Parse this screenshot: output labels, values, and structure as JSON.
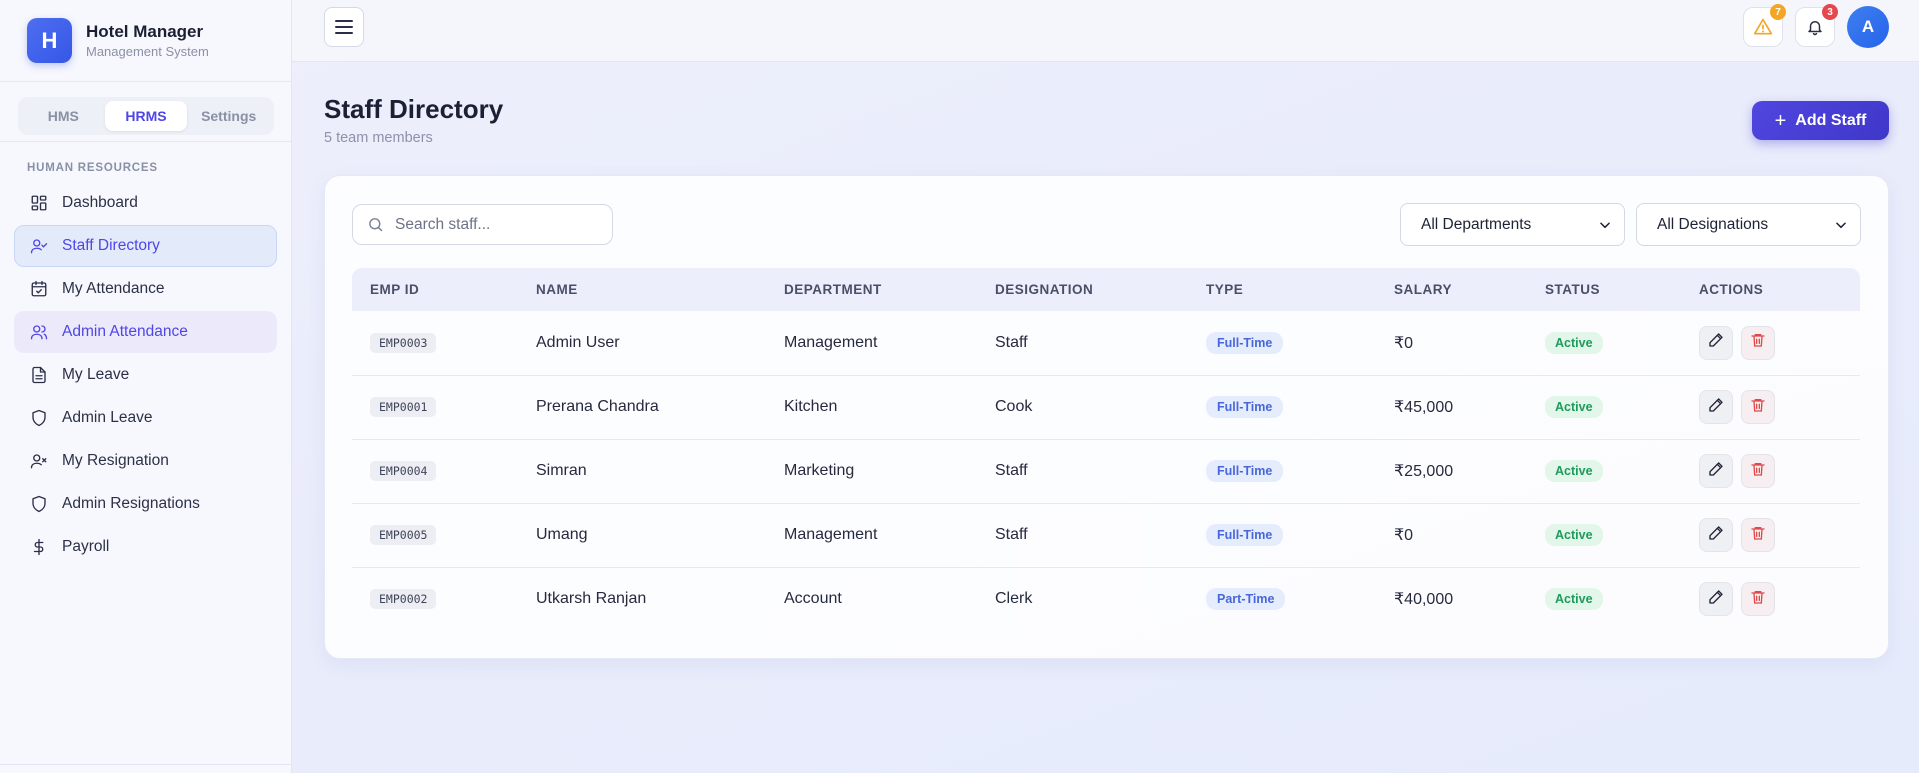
{
  "brand": {
    "logo_letter": "H",
    "title": "Hotel Manager",
    "subtitle": "Management System"
  },
  "module_tabs": [
    {
      "label": "HMS",
      "active": false
    },
    {
      "label": "HRMS",
      "active": true
    },
    {
      "label": "Settings",
      "active": false
    }
  ],
  "sidebar": {
    "section_label": "HUMAN RESOURCES",
    "items": [
      {
        "label": "Dashboard",
        "icon": "dashboard-icon",
        "state": ""
      },
      {
        "label": "Staff Directory",
        "icon": "user-check-icon",
        "state": "active"
      },
      {
        "label": "My Attendance",
        "icon": "calendar-check-icon",
        "state": ""
      },
      {
        "label": "Admin Attendance",
        "icon": "users-icon",
        "state": "hover"
      },
      {
        "label": "My Leave",
        "icon": "file-text-icon",
        "state": ""
      },
      {
        "label": "Admin Leave",
        "icon": "shield-icon",
        "state": ""
      },
      {
        "label": "My Resignation",
        "icon": "user-x-icon",
        "state": ""
      },
      {
        "label": "Admin Resignations",
        "icon": "shield-icon",
        "state": ""
      },
      {
        "label": "Payroll",
        "icon": "dollar-icon",
        "state": ""
      }
    ]
  },
  "header": {
    "alerts_count": "7",
    "notifications_count": "3",
    "avatar_letter": "A"
  },
  "page": {
    "title": "Staff Directory",
    "subtitle": "5 team members",
    "add_button": "Add Staff"
  },
  "filters": {
    "search_placeholder": "Search staff...",
    "department": "All Departments",
    "designation": "All Designations"
  },
  "table": {
    "columns": [
      "EMP ID",
      "NAME",
      "DEPARTMENT",
      "DESIGNATION",
      "TYPE",
      "SALARY",
      "STATUS",
      "ACTIONS"
    ],
    "rows": [
      {
        "emp_id": "EMP0003",
        "name": "Admin User",
        "department": "Management",
        "designation": "Staff",
        "type": "Full-Time",
        "salary": "₹0",
        "status": "Active"
      },
      {
        "emp_id": "EMP0001",
        "name": "Prerana Chandra",
        "department": "Kitchen",
        "designation": "Cook",
        "type": "Full-Time",
        "salary": "₹45,000",
        "status": "Active"
      },
      {
        "emp_id": "EMP0004",
        "name": "Simran",
        "department": "Marketing",
        "designation": "Staff",
        "type": "Full-Time",
        "salary": "₹25,000",
        "status": "Active"
      },
      {
        "emp_id": "EMP0005",
        "name": "Umang",
        "department": "Management",
        "designation": "Staff",
        "type": "Full-Time",
        "salary": "₹0",
        "status": "Active"
      },
      {
        "emp_id": "EMP0002",
        "name": "Utkarsh Ranjan",
        "department": "Account",
        "designation": "Clerk",
        "type": "Part-Time",
        "salary": "₹40,000",
        "status": "Active"
      }
    ]
  },
  "colors": {
    "accent": "#4f46e5",
    "alert_badge": "#f5a524",
    "notification_badge": "#e5484d",
    "active_status": "#1f9b5c",
    "delete": "#e04848"
  }
}
